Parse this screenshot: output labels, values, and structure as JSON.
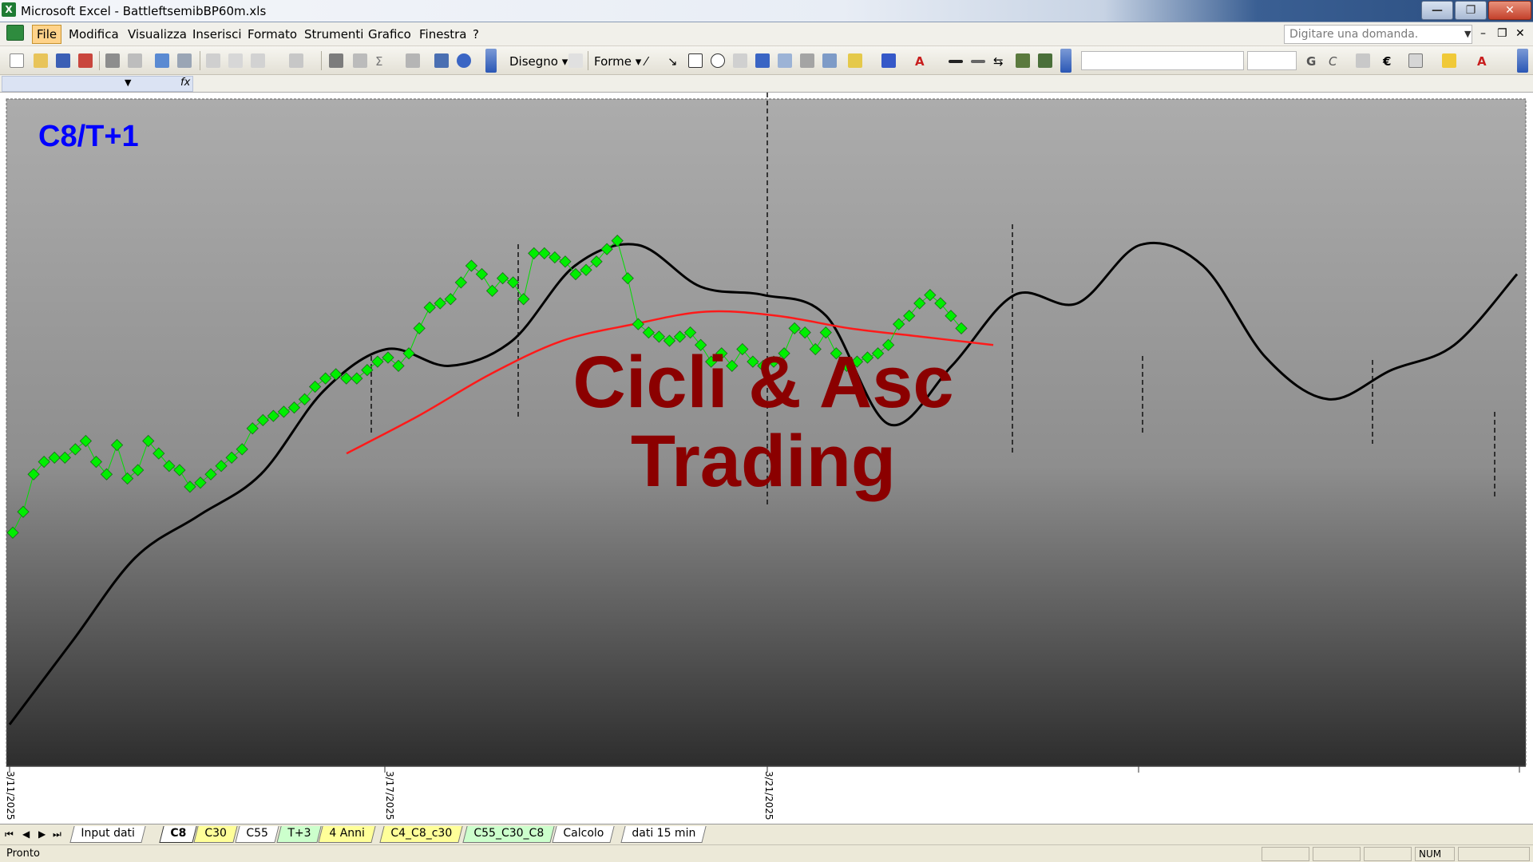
{
  "window": {
    "title": "Microsoft Excel - BattleftsemibBP60m.xls",
    "app_icon": "X"
  },
  "menu": {
    "items": [
      "File",
      "Modifica",
      "Visualizza",
      "Inserisci",
      "Formato",
      "Strumenti",
      "Grafico",
      "Finestra",
      "?"
    ],
    "help_placeholder": "Digitare una domanda."
  },
  "toolbar": {
    "draw_label": "Disegno",
    "shapes_label": "Forme"
  },
  "formula_bar": {
    "fx": "fx"
  },
  "chart": {
    "tag": "C8/T+1",
    "watermark_line1": "Cicli & Asc",
    "watermark_line2": "Trading",
    "x_tick_labels": [
      "3/11/2025",
      "3/17/2025",
      "3/21/2025"
    ],
    "colors": {
      "price": "#00ee00",
      "cycle": "#000000",
      "average": "#ff0000",
      "title": "#0000ff",
      "watermark": "#8b0000"
    }
  },
  "chart_data": {
    "type": "line",
    "x_tick_labels": [
      "3/11/2025",
      "3/17/2025",
      "3/21/2025"
    ],
    "series": [
      {
        "marker": "diamond",
        "color": "#00ee00",
        "values": [
          0.56,
          0.61,
          0.7,
          0.73,
          0.74,
          0.74,
          0.76,
          0.78,
          0.73,
          0.7,
          0.77,
          0.69,
          0.71,
          0.78,
          0.75,
          0.72,
          0.71,
          0.67,
          0.68,
          0.7,
          0.72,
          0.74,
          0.76,
          0.81,
          0.83,
          0.84,
          0.85,
          0.86,
          0.88,
          0.91,
          0.93,
          0.94,
          0.93,
          0.93,
          0.95,
          0.97,
          0.98,
          0.96,
          0.99,
          1.05,
          1.1,
          1.11,
          1.12,
          1.16,
          1.2,
          1.18,
          1.14,
          1.17,
          1.16,
          1.12,
          1.23,
          1.23,
          1.22,
          1.21,
          1.18,
          1.19,
          1.21,
          1.24,
          1.26,
          1.17,
          1.06,
          1.04,
          1.03,
          1.02,
          1.03,
          1.04,
          1.01,
          0.97,
          0.99,
          0.96,
          1.0,
          0.97,
          0.96,
          0.97,
          0.99,
          1.05,
          1.04,
          1.0,
          1.04,
          0.99,
          0.96,
          0.97,
          0.98,
          0.99,
          1.01,
          1.06,
          1.08,
          1.11,
          1.13,
          1.11,
          1.08,
          1.05
        ]
      },
      {
        "color": "#000000",
        "values": [
          0.1,
          0.3,
          0.5,
          0.6,
          0.7,
          0.9,
          1.0,
          0.96,
          1.02,
          1.2,
          1.25,
          1.15,
          1.13,
          1.08,
          0.82,
          0.96,
          1.13,
          1.11,
          1.25,
          1.2,
          0.98,
          0.88,
          0.95,
          1.01,
          1.18
        ]
      },
      {
        "color": "#ff0000",
        "values": [
          0.75,
          0.84,
          0.94,
          1.02,
          1.06,
          1.09,
          1.08,
          1.05,
          1.03,
          1.01
        ]
      }
    ]
  }
}
